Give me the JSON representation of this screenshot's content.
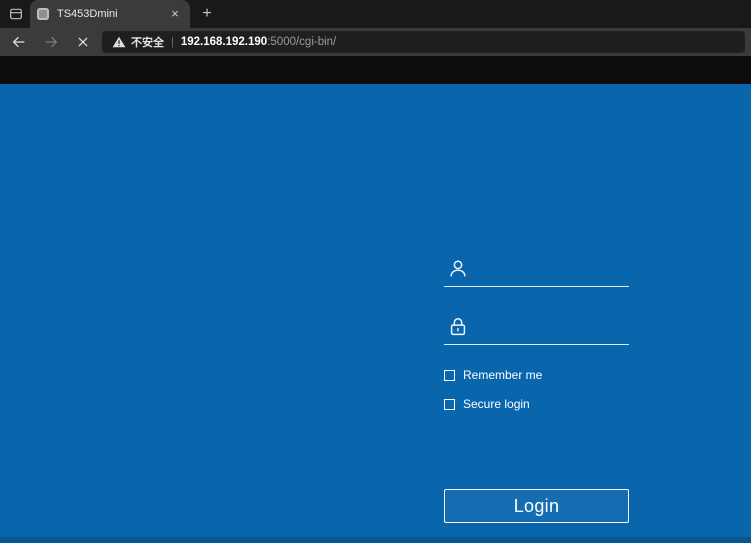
{
  "browser": {
    "tab_bar": {
      "tab": {
        "title": "TS453Dmini",
        "close_glyph": "×"
      },
      "new_tab_glyph": "+"
    },
    "toolbar": {
      "address": {
        "warning_label": "不安全",
        "separator": "|",
        "host": "192.168.192.190",
        "path_suffix": ":5000/cgi-bin/"
      }
    }
  },
  "login": {
    "username_value": "",
    "password_value": "",
    "checkboxes": [
      {
        "label": "Remember me",
        "checked": false
      },
      {
        "label": "Secure login",
        "checked": false
      }
    ],
    "login_button_label": "Login"
  },
  "colors": {
    "page_blue": "#0966ad",
    "chrome_dark": "#191919",
    "toolbar_gray": "#3b3b3b"
  }
}
